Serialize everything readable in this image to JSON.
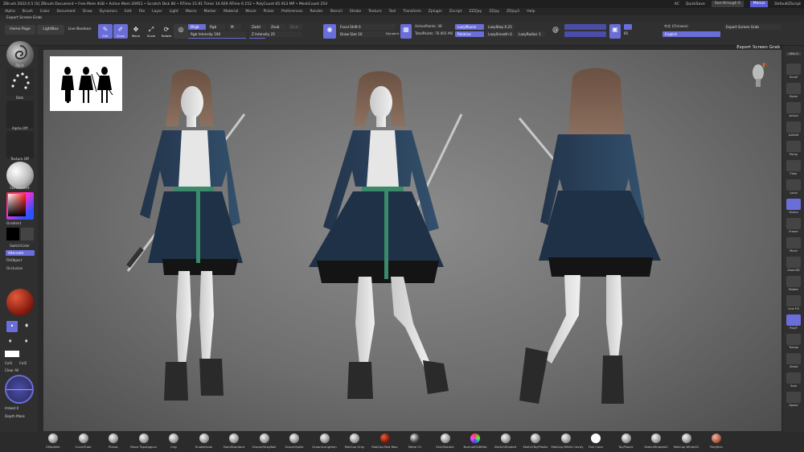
{
  "titlebar": {
    "title": "ZBrush 2022.0.5 [S]   ZBrush Document   • Free Mem 4GB • Active Mem 20951 • Scratch Disk 80 • RTime 15.91 Timer 14.929 ATime 6.152 • PolyCount 65.913 MP • MeshCount 254",
    "ac": "AC",
    "quicksave": "QuickSave",
    "seethrough": "See-through  0",
    "menus": "Menus",
    "default_zscript": "DefaultZScript"
  },
  "menubar": [
    "Alpha",
    "Brush",
    "Color",
    "Document",
    "Draw",
    "Dynamics",
    "Edit",
    "File",
    "Layer",
    "Light",
    "Macro",
    "Marker",
    "Material",
    "Movie",
    "Picker",
    "Preferences",
    "Render",
    "Stencil",
    "Stroke",
    "Texture",
    "Tool",
    "Transform",
    "Zplugin",
    "Zscript",
    "ZZZjay",
    "ZZjay",
    "ZDjay2",
    "Help"
  ],
  "secondbar": "Export Screen Grab",
  "toolbar": {
    "home_page": "Home Page",
    "lightbox": "LightBox",
    "live_boolean": "Live Boolean",
    "edit": "Edit",
    "draw": "Draw",
    "move": "Move",
    "scale": "Scale",
    "rotate": "Rotate",
    "mrgb": "Mrgb",
    "rgb": "Rgb",
    "m": "M",
    "rgb_intensity": "Rgb Intensity 100",
    "zadd": "Zadd",
    "zsub": "Zsub",
    "zcut": "Zcut",
    "z_intensity": "Z Intensity 25",
    "focal_shift": "Focal Shift 0",
    "draw_size": "Draw Size 10",
    "dynamic": "Dynamic",
    "active_points": "ActivePoints: 36",
    "total_points": "TotalPoints: 76.001 Mil",
    "lazymouse": "LazyMouse",
    "lazystep": "LazyStep 0.25",
    "lazysmooth": "LazySmooth 0",
    "lazyradius": "LazyRadius 1",
    "relative": "Relative",
    "value_85": "85",
    "language_label": "中文 (Chinese)",
    "english": "English",
    "export_screen_grab": "Export Screen Grab"
  },
  "viewport": {
    "caption": "Export Screen Grab"
  },
  "leftshelf": {
    "brush_label": "Paint",
    "stroke_label": "Dots",
    "alpha_label": "Alpha Off",
    "texture_label": "Texture Off",
    "material_label": "SkinShade4",
    "gradient_label": "Gradient",
    "switch_color": "SwitchColor",
    "alternate": "Alternate",
    "fill_object": "FillObject",
    "occlusion": "Occlusion",
    "col1": "Col1",
    "col2": "Col2",
    "clear_all": "Clear All",
    "imbed": "Imbed 0",
    "depth_mask": "Depth Mask"
  },
  "rightshelf": {
    "spix": "SPix 3",
    "labels": [
      "Scroll",
      "Zoom",
      "Actual",
      "AAHalf",
      "Persp",
      "Floor",
      "Local",
      "Gizmo",
      "Frame",
      "Move",
      "Zoom3D",
      "Rotate",
      "Line Fill",
      "PolyF",
      "Transp",
      "Ghost",
      "Solo",
      "Xpose"
    ]
  },
  "bottombar": {
    "brushes": [
      "ZModeler",
      "CurveTube",
      "Planar",
      "Move Topological",
      "Clay",
      "SnakeHook",
      "DamStandard",
      "GroomStrayBall",
      "GroomSpike",
      "GroomLengthen",
      "MatCap Gray",
      "MatCap Red Wax",
      "Metal 01",
      "SkinShade4",
      "NormalRGBMat",
      "SketchShaded",
      "SketchToyPlastic",
      "MatCap White Cavity",
      "Flat Color",
      "ToyPlastic",
      "SketchShaded2",
      "MatCap White01",
      "PolySkin"
    ]
  },
  "colors": {
    "accent": "#6a6ed9",
    "panel": "#303030",
    "background": "#2a2a2a"
  }
}
